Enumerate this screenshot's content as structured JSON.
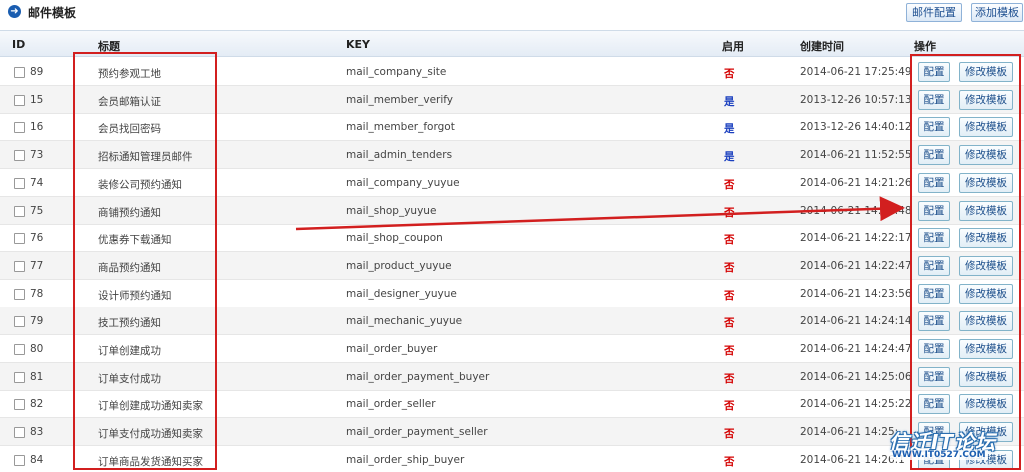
{
  "header": {
    "title": "邮件模板",
    "config_button": "邮件配置",
    "add_button": "添加模板"
  },
  "columns": {
    "id": "ID",
    "title": "标题",
    "key": "KEY",
    "enabled": "启用",
    "created": "创建时间",
    "actions": "操作"
  },
  "row_buttons": {
    "config": "配置",
    "edit": "修改模板"
  },
  "rows": [
    {
      "id": "89",
      "title": "预约参观工地",
      "key": "mail_company_site",
      "enabled": "否",
      "created": "2014-06-21 17:25:49"
    },
    {
      "id": "15",
      "title": "会员邮箱认证",
      "key": "mail_member_verify",
      "enabled": "是",
      "created": "2013-12-26 10:57:13"
    },
    {
      "id": "16",
      "title": "会员找回密码",
      "key": "mail_member_forgot",
      "enabled": "是",
      "created": "2013-12-26 14:40:12"
    },
    {
      "id": "73",
      "title": "招标通知管理员邮件",
      "key": "mail_admin_tenders",
      "enabled": "是",
      "created": "2014-06-21 11:52:55"
    },
    {
      "id": "74",
      "title": "装修公司预约通知",
      "key": "mail_company_yuyue",
      "enabled": "否",
      "created": "2014-06-21 14:21:26"
    },
    {
      "id": "75",
      "title": "商铺预约通知",
      "key": "mail_shop_yuyue",
      "enabled": "否",
      "created": "2014-06-21 14:21:48"
    },
    {
      "id": "76",
      "title": "优惠券下载通知",
      "key": "mail_shop_coupon",
      "enabled": "否",
      "created": "2014-06-21 14:22:17"
    },
    {
      "id": "77",
      "title": "商品预约通知",
      "key": "mail_product_yuyue",
      "enabled": "否",
      "created": "2014-06-21 14:22:47"
    },
    {
      "id": "78",
      "title": "设计师预约通知",
      "key": "mail_designer_yuyue",
      "enabled": "否",
      "created": "2014-06-21 14:23:56"
    },
    {
      "id": "79",
      "title": "技工预约通知",
      "key": "mail_mechanic_yuyue",
      "enabled": "否",
      "created": "2014-06-21 14:24:14"
    },
    {
      "id": "80",
      "title": "订单创建成功",
      "key": "mail_order_buyer",
      "enabled": "否",
      "created": "2014-06-21 14:24:47"
    },
    {
      "id": "81",
      "title": "订单支付成功",
      "key": "mail_order_payment_buyer",
      "enabled": "否",
      "created": "2014-06-21 14:25:06"
    },
    {
      "id": "82",
      "title": "订单创建成功通知卖家",
      "key": "mail_order_seller",
      "enabled": "否",
      "created": "2014-06-21 14:25:22"
    },
    {
      "id": "83",
      "title": "订单支付成功通知卖家",
      "key": "mail_order_payment_seller",
      "enabled": "否",
      "created": "2014-06-21 14:25:"
    },
    {
      "id": "84",
      "title": "订单商品发货通知买家",
      "key": "mail_order_ship_buyer",
      "enabled": "否",
      "created": "2014-06-21 14:26:1"
    }
  ],
  "watermark": {
    "big": "信迁IT论坛",
    "small": "WWW.IT0527.COM"
  }
}
